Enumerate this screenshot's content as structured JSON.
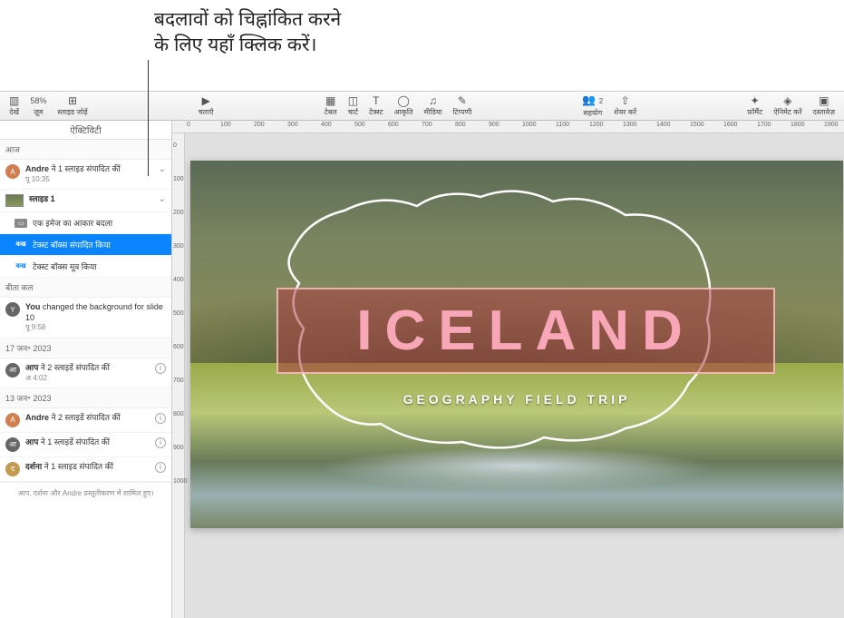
{
  "callout": {
    "line1": "बदलावों को चिह्नांकित करने",
    "line2": "के लिए यहाँ क्लिक करें।"
  },
  "toolbar": {
    "view": "देखें",
    "zoom_value": "58%",
    "zoom": "ज़ूम",
    "add_slide": "स्लाइड जोड़ें",
    "play": "चलाएँ",
    "table": "टेबल",
    "chart": "चार्ट",
    "text": "टेक्स्ट",
    "shape": "आकृति",
    "media": "मीडिया",
    "comment": "टिप्पणी",
    "collab_count": "2",
    "collaborate": "सहयोग",
    "share": "शेयर करें",
    "format": "फ़ॉर्मैट",
    "animate": "ऐनिमेट करें",
    "document": "दस्तावेज़"
  },
  "sidebar": {
    "title": "ऐक्टिविटी",
    "sections": {
      "today": "आज",
      "yesterday": "बीता कल",
      "jan17": "17 जन॰ 2023",
      "jan13": "13 जन॰ 2023"
    },
    "items": {
      "andre_edit": {
        "bold": "Andre",
        "rest": " ने 1 स्लाइड संपादित कीं",
        "time": "पू 10:35"
      },
      "slide1": "स्लाइड 1",
      "resize": "एक इमेज का आकार बदला",
      "textbox_edit": "टेक्स्ट बॉक्स संपादित किया",
      "textbox_move": "टेक्स्ट बॉक्स मूव किया",
      "you_bg": {
        "bold": "You",
        "rest": " changed the background for slide 10",
        "time": "पू 9:58"
      },
      "you_edit2": {
        "bold": "आप",
        "rest": " ने 2 स्लाइडें संपादित कीं",
        "time": "अ 4:02"
      },
      "andre_edit2": {
        "bold": "Andre",
        "rest": " ने 2 स्लाइडें संपादित कीं"
      },
      "you_edit1": {
        "bold": "आप",
        "rest": " ने 1 स्लाइडें संपादित कीं"
      },
      "darshana": {
        "bold": "दर्शना",
        "rest": " ने 1 स्लाइड संपादित कीं"
      }
    },
    "textbox_icon": "कख",
    "footer": "आप, दर्शना और Andre प्रस्तुतीकरण में शामिल हुए।"
  },
  "slide": {
    "title": "ICELAND",
    "subtitle": "GEOGRAPHY FIELD TRIP"
  },
  "ruler_h": [
    "0",
    "100",
    "200",
    "300",
    "400",
    "500",
    "600",
    "700",
    "800",
    "900",
    "1000",
    "1100",
    "1200",
    "1300",
    "1400",
    "1500",
    "1600",
    "1700",
    "1800",
    "1900"
  ],
  "ruler_v": [
    "0",
    "100",
    "200",
    "300",
    "400",
    "500",
    "600",
    "700",
    "800",
    "900",
    "1000"
  ]
}
